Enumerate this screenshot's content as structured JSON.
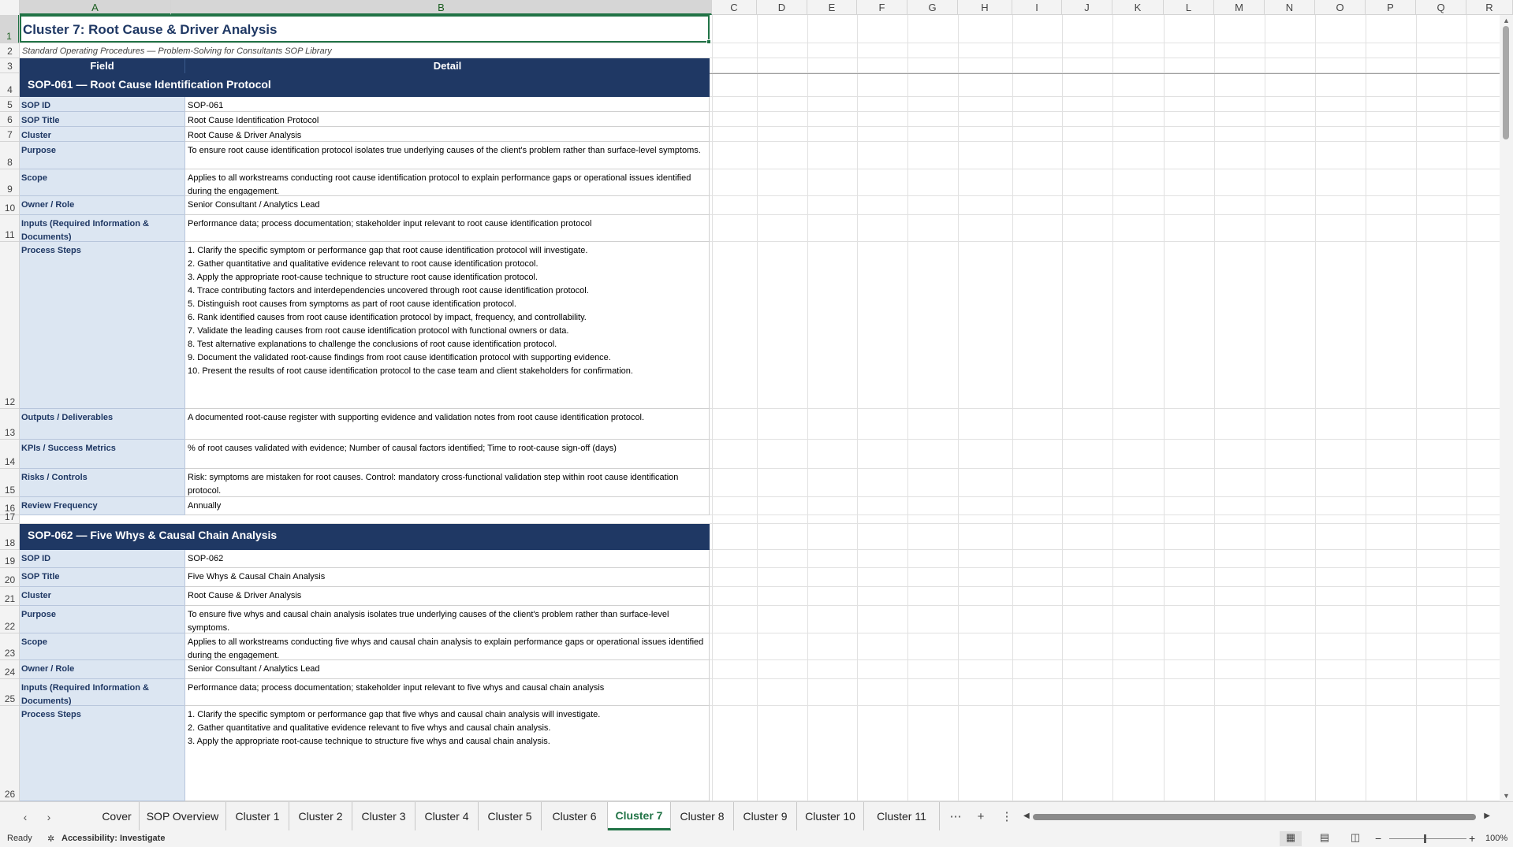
{
  "columns": [
    "A",
    "B",
    "C",
    "D",
    "E",
    "F",
    "G",
    "H",
    "I",
    "J",
    "K",
    "L",
    "M",
    "N",
    "O",
    "P",
    "Q",
    "R"
  ],
  "rows": [
    "1",
    "2",
    "3",
    "4",
    "5",
    "6",
    "7",
    "8",
    "9",
    "10",
    "11",
    "12",
    "13",
    "14",
    "15",
    "16",
    "17",
    "18",
    "19",
    "20",
    "21",
    "22",
    "23",
    "24",
    "25",
    "26"
  ],
  "sheet": {
    "title": "Cluster 7: Root Cause & Driver Analysis",
    "subtitle": "Standard Operating Procedures — Problem-Solving for Consultants SOP Library",
    "header_field": "Field",
    "header_detail": "Detail"
  },
  "sops": [
    {
      "bar": "SOP-061  —  Root Cause Identification Protocol",
      "fields": [
        {
          "label": "SOP ID",
          "value": "SOP-061"
        },
        {
          "label": "SOP Title",
          "value": "Root Cause Identification Protocol"
        },
        {
          "label": "Cluster",
          "value": "Root Cause & Driver Analysis"
        },
        {
          "label": "Purpose",
          "value": "To ensure root cause identification protocol isolates true underlying causes of the client's problem rather than surface-level symptoms."
        },
        {
          "label": "Scope",
          "value": "Applies to all workstreams conducting root cause identification protocol to explain performance gaps or operational issues identified during the engagement."
        },
        {
          "label": "Owner / Role",
          "value": "Senior Consultant / Analytics Lead"
        },
        {
          "label": "Inputs (Required Information & Documents)",
          "value": "Performance data; process documentation; stakeholder input relevant to root cause identification protocol"
        },
        {
          "label": "Process Steps",
          "value": "1. Clarify the specific symptom or performance gap that root cause identification protocol will investigate.\n2. Gather quantitative and qualitative evidence relevant to root cause identification protocol.\n3. Apply the appropriate root-cause technique to structure root cause identification protocol.\n4. Trace contributing factors and interdependencies uncovered through root cause identification protocol.\n5. Distinguish root causes from symptoms as part of root cause identification protocol.\n6. Rank identified causes from root cause identification protocol by impact, frequency, and controllability.\n7. Validate the leading causes from root cause identification protocol with functional owners or data.\n8. Test alternative explanations to challenge the conclusions of root cause identification protocol.\n9. Document the validated root-cause findings from root cause identification protocol with supporting evidence.\n10. Present the results of root cause identification protocol to the case team and client stakeholders for confirmation."
        },
        {
          "label": "Outputs / Deliverables",
          "value": "A documented root-cause register with supporting evidence and validation notes from root cause identification protocol."
        },
        {
          "label": "KPIs / Success Metrics",
          "value": "% of root causes validated with evidence; Number of causal factors identified; Time to root-cause sign-off (days)"
        },
        {
          "label": "Risks / Controls",
          "value": "Risk: symptoms are mistaken for root causes. Control: mandatory cross-functional validation step within root cause identification protocol."
        },
        {
          "label": "Review Frequency",
          "value": "Annually"
        }
      ]
    },
    {
      "bar": "SOP-062  —  Five Whys & Causal Chain Analysis",
      "fields": [
        {
          "label": "SOP ID",
          "value": "SOP-062"
        },
        {
          "label": "SOP Title",
          "value": "Five Whys & Causal Chain Analysis"
        },
        {
          "label": "Cluster",
          "value": "Root Cause & Driver Analysis"
        },
        {
          "label": "Purpose",
          "value": "To ensure five whys and causal chain analysis isolates true underlying causes of the client's problem rather than surface-level symptoms."
        },
        {
          "label": "Scope",
          "value": "Applies to all workstreams conducting five whys and causal chain analysis to explain performance gaps or operational issues identified during the engagement."
        },
        {
          "label": "Owner / Role",
          "value": "Senior Consultant / Analytics Lead"
        },
        {
          "label": "Inputs (Required Information & Documents)",
          "value": "Performance data; process documentation; stakeholder input relevant to five whys and causal chain analysis"
        },
        {
          "label": "Process Steps",
          "value": "1. Clarify the specific symptom or performance gap that five whys and causal chain analysis will investigate.\n2. Gather quantitative and qualitative evidence relevant to five whys and causal chain analysis.\n3. Apply the appropriate root-cause technique to structure five whys and causal chain analysis."
        }
      ]
    }
  ],
  "tabs": [
    "Cover",
    "SOP Overview",
    "Cluster 1",
    "Cluster 2",
    "Cluster 3",
    "Cluster 4",
    "Cluster 5",
    "Cluster 6",
    "Cluster 7",
    "Cluster 8",
    "Cluster 9",
    "Cluster 10",
    "Cluster 11"
  ],
  "active_tab": "Cluster 7",
  "status": {
    "ready": "Ready",
    "accessibility": "Accessibility: Investigate",
    "zoom": "100%"
  },
  "icons": {
    "prev": "chevron-left-icon",
    "next": "chevron-right-icon",
    "more_tabs": "ellipsis-icon",
    "add_sheet": "plus-icon",
    "options": "vertical-ellipsis-icon"
  },
  "colors": {
    "accent": "#217346",
    "navy": "#1f3864",
    "field_bg": "#dce6f2"
  }
}
